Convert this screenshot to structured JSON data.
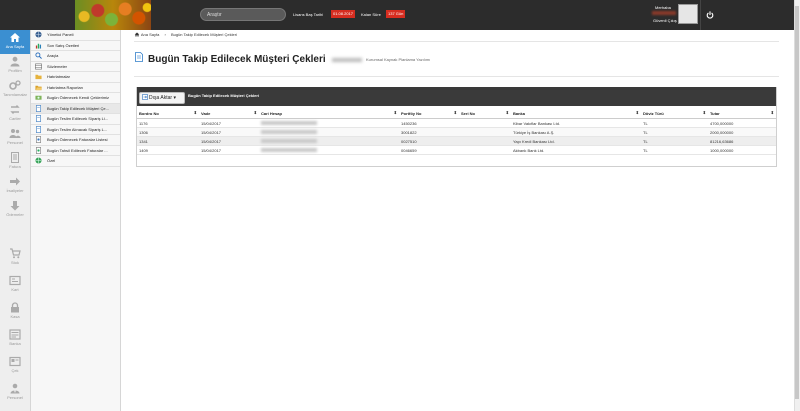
{
  "topbar": {
    "search_placeholder": "Araştır",
    "license_start_label": "Lisans Baş Tarihi",
    "license_start_value": "01.08.2017",
    "license_remaining_label": "Kalan Süre",
    "license_remaining_value": "137 Gün",
    "greeting": "Merhaba",
    "logout": "Güvenli Çıkış"
  },
  "iconbar": [
    {
      "label": "Ana Sayfa",
      "icon": "home-icon",
      "active": true
    },
    {
      "label": "Profilim",
      "icon": "user-icon"
    },
    {
      "label": "Tanımlamalar",
      "icon": "gears-icon"
    },
    {
      "label": "Cariler",
      "icon": "transfer-icon"
    },
    {
      "label": "Personel",
      "icon": "people-icon"
    },
    {
      "label": "Fatura",
      "icon": "document-icon"
    },
    {
      "label": "İrsaliyeler",
      "icon": "arrow-right-icon"
    },
    {
      "label": "Ödemeler",
      "icon": "arrow-down-icon"
    },
    {
      "label": "Stok",
      "icon": "cart-icon"
    },
    {
      "label": "Kart",
      "icon": "card-icon"
    },
    {
      "label": "Kasa",
      "icon": "lock-icon"
    },
    {
      "label": "Banka",
      "icon": "bank-icon"
    },
    {
      "label": "Çek",
      "icon": "check-icon"
    },
    {
      "label": "Personel",
      "icon": "person-tie-icon"
    }
  ],
  "menu": [
    "Yönetici Paneli",
    "Son Satış Özetleri",
    "Araçla",
    "Sözlemeler",
    "Hatırlatmalar",
    "Hatırlatma Raporları",
    "Bugün Ödenecek Kendi Çeklerimiz",
    "Bugün Takip Edilecek Müşteri Çe...",
    "Bugün Teslim Edilecek Sipariş Li...",
    "Bugün Teslim Alınacak Sipariş L...",
    "Bugün Ödenecek Faturalar Listesi",
    "Bugün Tahsil Edilecek Faturalar ...",
    "Özel"
  ],
  "breadcrumb": {
    "home": "Ana Sayfa",
    "separator": "›",
    "current": "Bugün Takip Edilecek Müşteri Çekleri"
  },
  "page": {
    "title": "Bugün Takip Edilecek Müşteri Çekleri",
    "subtitle": "Kurumsal Kaynak Planlama Yazılımı",
    "export_label": "Dışa Aktar",
    "panel_title": "Bugün Takip Edilecek Müşteri Çekleri"
  },
  "table": {
    "columns": [
      "Bordro No",
      "Vade",
      "Cari Hesap",
      "Portföy No",
      "Seri No",
      "Banka",
      "Döviz Türü",
      "Tutar"
    ],
    "rows": [
      [
        "1176",
        "15/04/2017",
        "",
        "1450236",
        "",
        "Kibar Vakıflar Bankası Ltd.",
        "TL",
        "4700,000000"
      ],
      [
        "1306",
        "15/04/2017",
        "",
        "3001822",
        "",
        "Türkiye İş Bankası A.Ş.",
        "TL",
        "2000,000000"
      ],
      [
        "1341",
        "15/04/2017",
        "",
        "0027510",
        "",
        "Yapı Kredi Bankası Ltd.",
        "TL",
        "81216,63686"
      ],
      [
        "1409",
        "15/04/2017",
        "",
        "0046659",
        "",
        "Akbank Bank Ltd.",
        "TL",
        "1000,000000"
      ]
    ]
  }
}
